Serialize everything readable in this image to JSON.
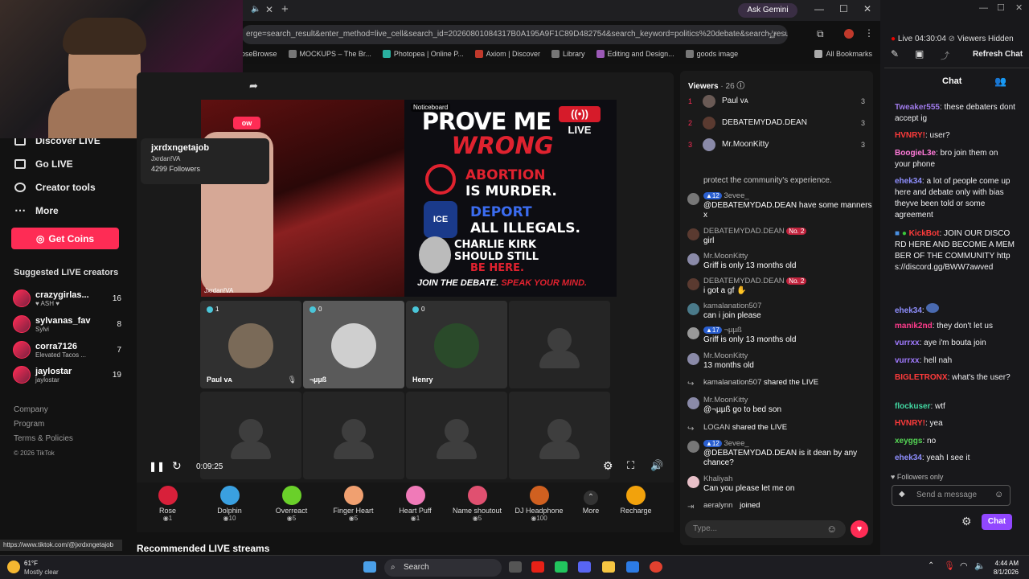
{
  "browser": {
    "url": "erge=search_result&enter_method=live_cell&search_id=20260801084317B0A195A9F1C89D482754&search_keyword=politics%20debate&search_result_id...",
    "ask_gemini": "Ask Gemini",
    "bookmarks": [
      "oseBrowse",
      "MOCKUPS – The Br...",
      "Photopea | Online P...",
      "Axiom | Discover",
      "Library",
      "Editing and Design...",
      "goods image"
    ],
    "all_bookmarks": "All Bookmarks",
    "status_url": "https://www.tiktok.com/@jxrdxngetajob"
  },
  "sidenav": {
    "items": [
      "Discover LIVE",
      "Go LIVE",
      "Creator tools",
      "More"
    ],
    "coins_button": "Get Coins",
    "suggested_title": "Suggested LIVE creators",
    "suggested": [
      {
        "name": "crazygirlas...",
        "sub": "♥ ASH ♥",
        "count": "16"
      },
      {
        "name": "sylvanas_fav",
        "sub": "Sylvi",
        "count": "8"
      },
      {
        "name": "corra7126",
        "sub": "Elevated Tacos ...",
        "count": "7"
      },
      {
        "name": "jaylostar",
        "sub": "jaylostar",
        "count": "19"
      }
    ],
    "footer": [
      "Company",
      "Program",
      "Terms & Policies",
      "© 2026 TikTok"
    ]
  },
  "profile_card": {
    "handle": "jxrdxngetajob",
    "name": "Jxrdan!VA",
    "followers": "4299 Followers",
    "follow_btn": "ow"
  },
  "stream": {
    "host_label": "Jxrdan!VA",
    "noticeboard": "Noticeboard",
    "poster": {
      "line1": "PROVE ME",
      "line2": "WRONG",
      "live": "LIVE",
      "abortion_a": "ABORTION",
      "abortion_b": "IS MURDER.",
      "ice": "ICE",
      "deport_a": "DEPORT",
      "deport_b": "ALL ILLEGALS.",
      "charlie_a": "CHARLIE KIRK",
      "charlie_b": "SHOULD STILL",
      "charlie_c": "BE HERE.",
      "footer_a": "JOIN THE DEBATE.",
      "footer_b": "SPEAK YOUR MIND."
    },
    "guests": [
      {
        "name": "Paul ᴠᴀ",
        "count": "1"
      },
      {
        "name": "¬µµß",
        "count": "0"
      },
      {
        "name": "Henry",
        "count": "0"
      }
    ],
    "time": "0:09:25"
  },
  "gifts": [
    {
      "name": "Rose",
      "price": "1",
      "color": "#d8203a"
    },
    {
      "name": "Dolphin",
      "price": "10",
      "color": "#3aa0e0"
    },
    {
      "name": "Overreact",
      "price": "5",
      "color": "#6ad02a"
    },
    {
      "name": "Finger Heart",
      "price": "5",
      "color": "#f0a070"
    },
    {
      "name": "Heart Puff",
      "price": "1",
      "color": "#f07ab8"
    },
    {
      "name": "Name shoutout",
      "price": "5",
      "color": "#e05070"
    },
    {
      "name": "DJ Headphone",
      "price": "100",
      "color": "#d06020"
    }
  ],
  "gift_more": "More",
  "recharge": "Recharge",
  "recommended": "Recommended LIVE streams",
  "viewers": {
    "title": "Viewers",
    "count": "· 26",
    "list": [
      {
        "rank": "1",
        "name": "Paul ᴠᴀ",
        "score": "3"
      },
      {
        "rank": "2",
        "name": "DEBATEMYDAD.DEAN",
        "score": "3"
      },
      {
        "rank": "3",
        "name": "Mr.MoonKitty",
        "score": "3"
      }
    ]
  },
  "chat": {
    "partial": "protect the community's experience.",
    "messages": [
      {
        "name": "3evee_",
        "tag": "12",
        "text": "@DEBATEMYDAD.DEAN have some manners x"
      },
      {
        "name": "DEBATEMYDAD.DEAN",
        "tag": "No. 2",
        "text": "girl"
      },
      {
        "name": "Mr.MoonKitty",
        "tag": "",
        "text": "Griff is only 13 months old"
      },
      {
        "name": "DEBATEMYDAD.DEAN",
        "tag": "No. 2",
        "text": "i got a gf ✋"
      },
      {
        "name": "kamalanation507",
        "tag": "",
        "text": "can i join please"
      },
      {
        "name": "¬µµß",
        "tag": "17",
        "text": "Griff is only 13 months old"
      },
      {
        "name": "Mr.MoonKitty",
        "tag": "",
        "text": "13 months old"
      },
      {
        "name": "kamalanation507",
        "tag": "",
        "text": "shared the LIVE"
      },
      {
        "name": "Mr.MoonKitty",
        "tag": "",
        "text": "@¬µµß go to bed son"
      },
      {
        "name": "LOGAN",
        "tag": "",
        "text": "shared the LIVE"
      },
      {
        "name": "3evee_",
        "tag": "12",
        "text": "@DEBATEMYDAD.DEAN is it dean by any chance?"
      },
      {
        "name": "Khaliyah",
        "tag": "",
        "text": "Can you please let me on"
      },
      {
        "name": "aeralynn",
        "tag": "",
        "text": "joined"
      }
    ],
    "placeholder": "Type..."
  },
  "twitch": {
    "live_time": "Live 04:30:04",
    "viewers_hidden": "Viewers Hidden",
    "refresh": "Refresh Chat",
    "title": "Chat",
    "messages": [
      {
        "user": "Tweaker555",
        "color": "#9f7aea",
        "text": ": these debaters dont accept ig"
      },
      {
        "user": "HVNRY!",
        "color": "#ff3b3b",
        "text": ": user?"
      },
      {
        "user": "BoogieL3e",
        "color": "#ff7ad9",
        "text": ": bro join them on your phone"
      },
      {
        "user": "ehek34",
        "color": "#8f8fff",
        "text": ": a lot of people come up here and debate only with bias theyve been told or some agreement"
      },
      {
        "user": "KickBot",
        "color": "#ff3b3b",
        "text": ": JOIN OUR DISCORD HERE AND BECOME A MEMBER OF THE COMMUNITY https://discord.gg/BWW7awved"
      },
      {
        "user": "ehek34",
        "color": "#8f8fff",
        "text": ":"
      },
      {
        "user": "manik2nd",
        "color": "#ff3b8c",
        "text": ": they don't let us"
      },
      {
        "user": "vurrxx",
        "color": "#a07aff",
        "text": ": aye i'm bouta join"
      },
      {
        "user": "vurrxx",
        "color": "#a07aff",
        "text": ": hell nah"
      },
      {
        "user": "BIGLETRONX",
        "color": "#ff3b3b",
        "text": ": what's the user?"
      },
      {
        "user": "flockuser",
        "color": "#42d7a2",
        "text": ": wtf"
      },
      {
        "user": "HVNRY!",
        "color": "#ff3b3b",
        "text": ": yea"
      },
      {
        "user": "xeyggs",
        "color": "#55d655",
        "text": ": no"
      },
      {
        "user": "ehek34",
        "color": "#8f8fff",
        "text": ": yeah I see it"
      }
    ],
    "followers_only": "Followers only",
    "send_placeholder": "Send a message",
    "chat_btn": "Chat"
  },
  "taskbar": {
    "weather_temp": "61°F",
    "weather_desc": "Mostly clear",
    "search": "Search",
    "time": "4:44 AM",
    "date": "8/1/2026"
  }
}
